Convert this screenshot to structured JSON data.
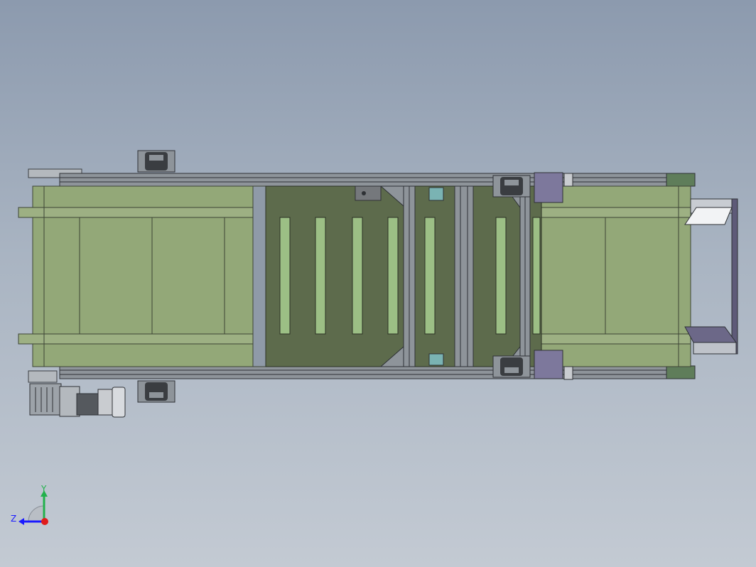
{
  "triad": {
    "y_label": "Y",
    "z_label": "Z",
    "y_color": "#22b14c",
    "z_color": "#1a1aff",
    "x_color": "#e01b1b"
  },
  "colors": {
    "belt_green": "#93a878",
    "belt_green_dark": "#5d6b4c",
    "frame_gray": "#8e949a",
    "frame_dark": "#3a3d41",
    "bracket_purple": "#7d789c",
    "slat_green": "#9cbf85",
    "teal_block": "#7ab3b3"
  }
}
